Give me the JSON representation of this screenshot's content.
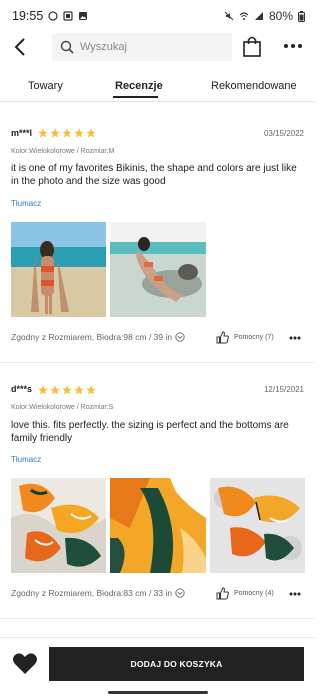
{
  "status": {
    "time": "19:55",
    "battery": "80%"
  },
  "header": {
    "search_placeholder": "Wyszukaj"
  },
  "tabs": [
    {
      "label": "Towary"
    },
    {
      "label": "Recenzje"
    },
    {
      "label": "Rekomendowane"
    }
  ],
  "reviews": [
    {
      "user": "m***l",
      "rating": 5,
      "date": "03/15/2022",
      "variant": "Kolor:Wielokolorowe / Rozmiar:M",
      "text": "it is one of my favorites Bikinis, the shape and colors are just like in the photo and the size was good",
      "translate": "Tłumacz",
      "fit": "Zgodny z Rozmiarem, Biodra:98 cm / 39 in",
      "helpful": "Pomocny (7)"
    },
    {
      "user": "d***s",
      "rating": 5,
      "date": "12/15/2021",
      "variant": "Kolor:Wielokolorowe / Rozmiar:S",
      "text": "love this. fits perfectly. the sizing is perfect and the bottoms are family friendly",
      "translate": "Tłumacz",
      "fit": "Zgodny z Rozmiarem, Biodra:83 cm / 33 in",
      "helpful": "Pomocny (4)"
    }
  ],
  "bottom_bar": {
    "cart_label": "DODAJ DO KOSZYKA"
  },
  "colors": {
    "star": "#f6c03b",
    "link": "#2a7bd1",
    "button": "#222222"
  }
}
